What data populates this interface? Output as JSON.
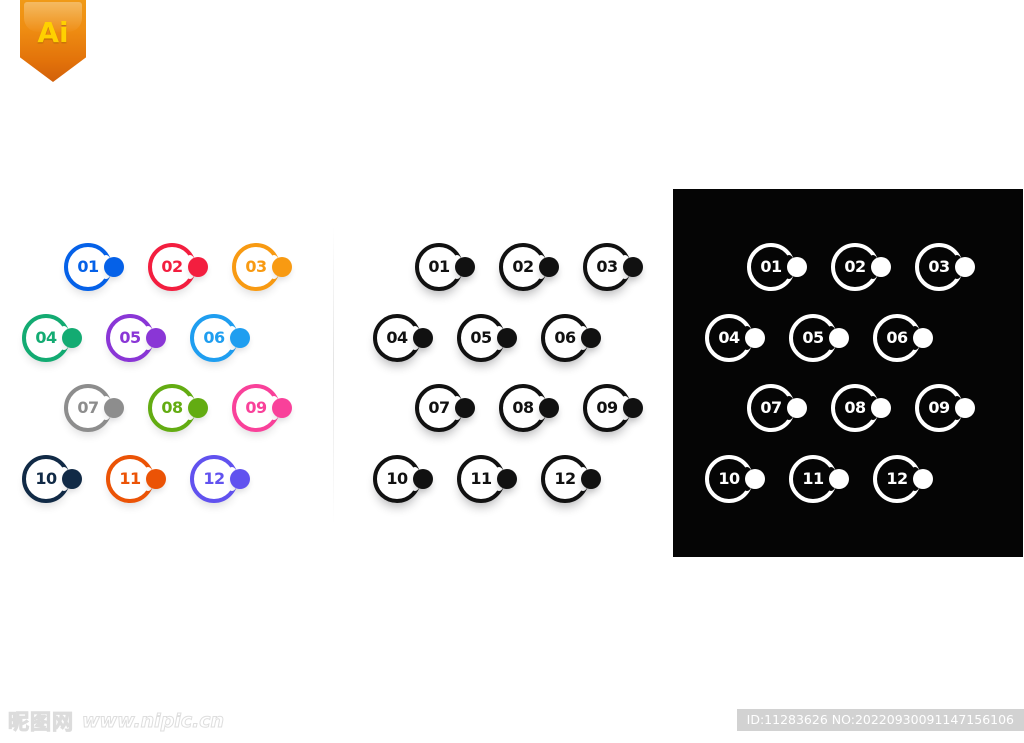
{
  "badge": {
    "label": "Ai",
    "icon": "illustrator-ribbon-icon",
    "color": "#ef8d12",
    "text_color": "#ffd000"
  },
  "panels": [
    {
      "id": "color",
      "name": "colored-icon-set",
      "background": "#ffffff"
    },
    {
      "id": "mono",
      "name": "black-icon-set",
      "background": "#ffffff",
      "stroke": "#111111"
    },
    {
      "id": "dark",
      "name": "white-on-black-icon-set",
      "background": "#050505",
      "stroke": "#ffffff"
    }
  ],
  "icons": [
    {
      "num": "01",
      "color": "#0561e8",
      "row": 0,
      "col": 0
    },
    {
      "num": "02",
      "color": "#f31e3f",
      "row": 0,
      "col": 1
    },
    {
      "num": "03",
      "color": "#f89a12",
      "row": 0,
      "col": 2
    },
    {
      "num": "04",
      "color": "#13ab72",
      "row": 1,
      "col": 0
    },
    {
      "num": "05",
      "color": "#8a36d6",
      "row": 1,
      "col": 1
    },
    {
      "num": "06",
      "color": "#1f9ef0",
      "row": 1,
      "col": 2
    },
    {
      "num": "07",
      "color": "#8d8d8d",
      "row": 2,
      "col": 0
    },
    {
      "num": "08",
      "color": "#63ac12",
      "row": 2,
      "col": 1
    },
    {
      "num": "09",
      "color": "#f9419a",
      "row": 2,
      "col": 2
    },
    {
      "num": "10",
      "color": "#112a46",
      "row": 3,
      "col": 0
    },
    {
      "num": "11",
      "color": "#eb5306",
      "row": 3,
      "col": 1
    },
    {
      "num": "12",
      "color": "#6152ef",
      "row": 3,
      "col": 2
    }
  ],
  "footer": {
    "watermark_cn": "昵图网",
    "watermark_url": "www.nipic.cn",
    "id_text": "ID:11283626 NO:20220930091147156106"
  }
}
